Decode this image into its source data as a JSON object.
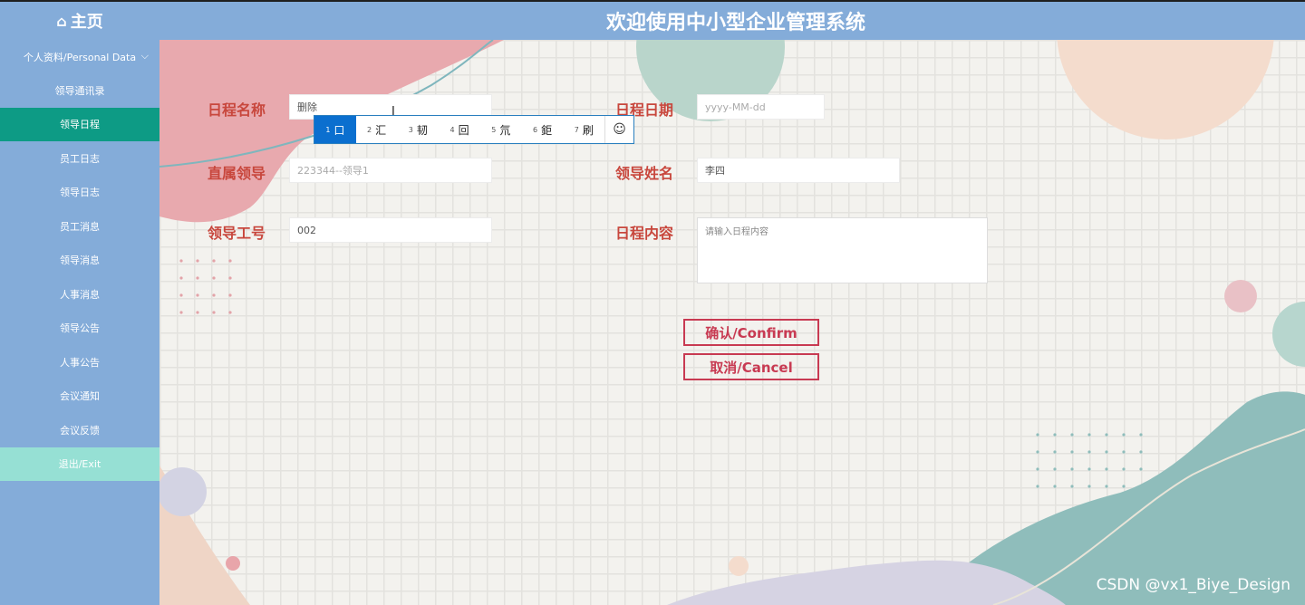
{
  "header": {
    "home_label": "主页",
    "home_icon": "home-icon",
    "title": "欢迎使用中小型企业管理系统"
  },
  "sidebar": {
    "group_label": "个人资料/Personal Data",
    "items": [
      {
        "label": "领导通讯录"
      },
      {
        "label": "领导日程"
      },
      {
        "label": "员工日志"
      },
      {
        "label": "领导日志"
      },
      {
        "label": "员工消息"
      },
      {
        "label": "领导消息"
      },
      {
        "label": "人事消息"
      },
      {
        "label": "领导公告"
      },
      {
        "label": "人事公告"
      },
      {
        "label": "会议通知"
      },
      {
        "label": "会议反馈"
      },
      {
        "label": "退出/Exit"
      }
    ]
  },
  "form": {
    "schedule_name_label": "日程名称",
    "schedule_name_value": "删除",
    "schedule_date_label": "日程日期",
    "schedule_date_placeholder": "yyyy-MM-dd",
    "direct_leader_label": "直属领导",
    "direct_leader_placeholder": "223344--领导1",
    "leader_name_label": "领导姓名",
    "leader_name_value": "李四",
    "leader_id_label": "领导工号",
    "leader_id_value": "002",
    "content_label": "日程内容",
    "content_placeholder": "请输入日程内容",
    "confirm_label": "确认/Confirm",
    "cancel_label": "取消/Cancel"
  },
  "ime": {
    "candidates": [
      {
        "num": "1",
        "text": "口"
      },
      {
        "num": "2",
        "text": "汇"
      },
      {
        "num": "3",
        "text": "韧"
      },
      {
        "num": "4",
        "text": "回"
      },
      {
        "num": "5",
        "text": "氘"
      },
      {
        "num": "6",
        "text": "鉅"
      },
      {
        "num": "7",
        "text": "刷"
      }
    ],
    "emoji_icon": "smiley-icon",
    "emoji_glyph": "☺"
  },
  "watermark": "CSDN @vx1_Biye_Design",
  "colors": {
    "sidebar": "#84acd9",
    "active": "#0d9b85",
    "exit": "#96e0d4",
    "label": "#c8473d",
    "button": "#c83a52"
  }
}
